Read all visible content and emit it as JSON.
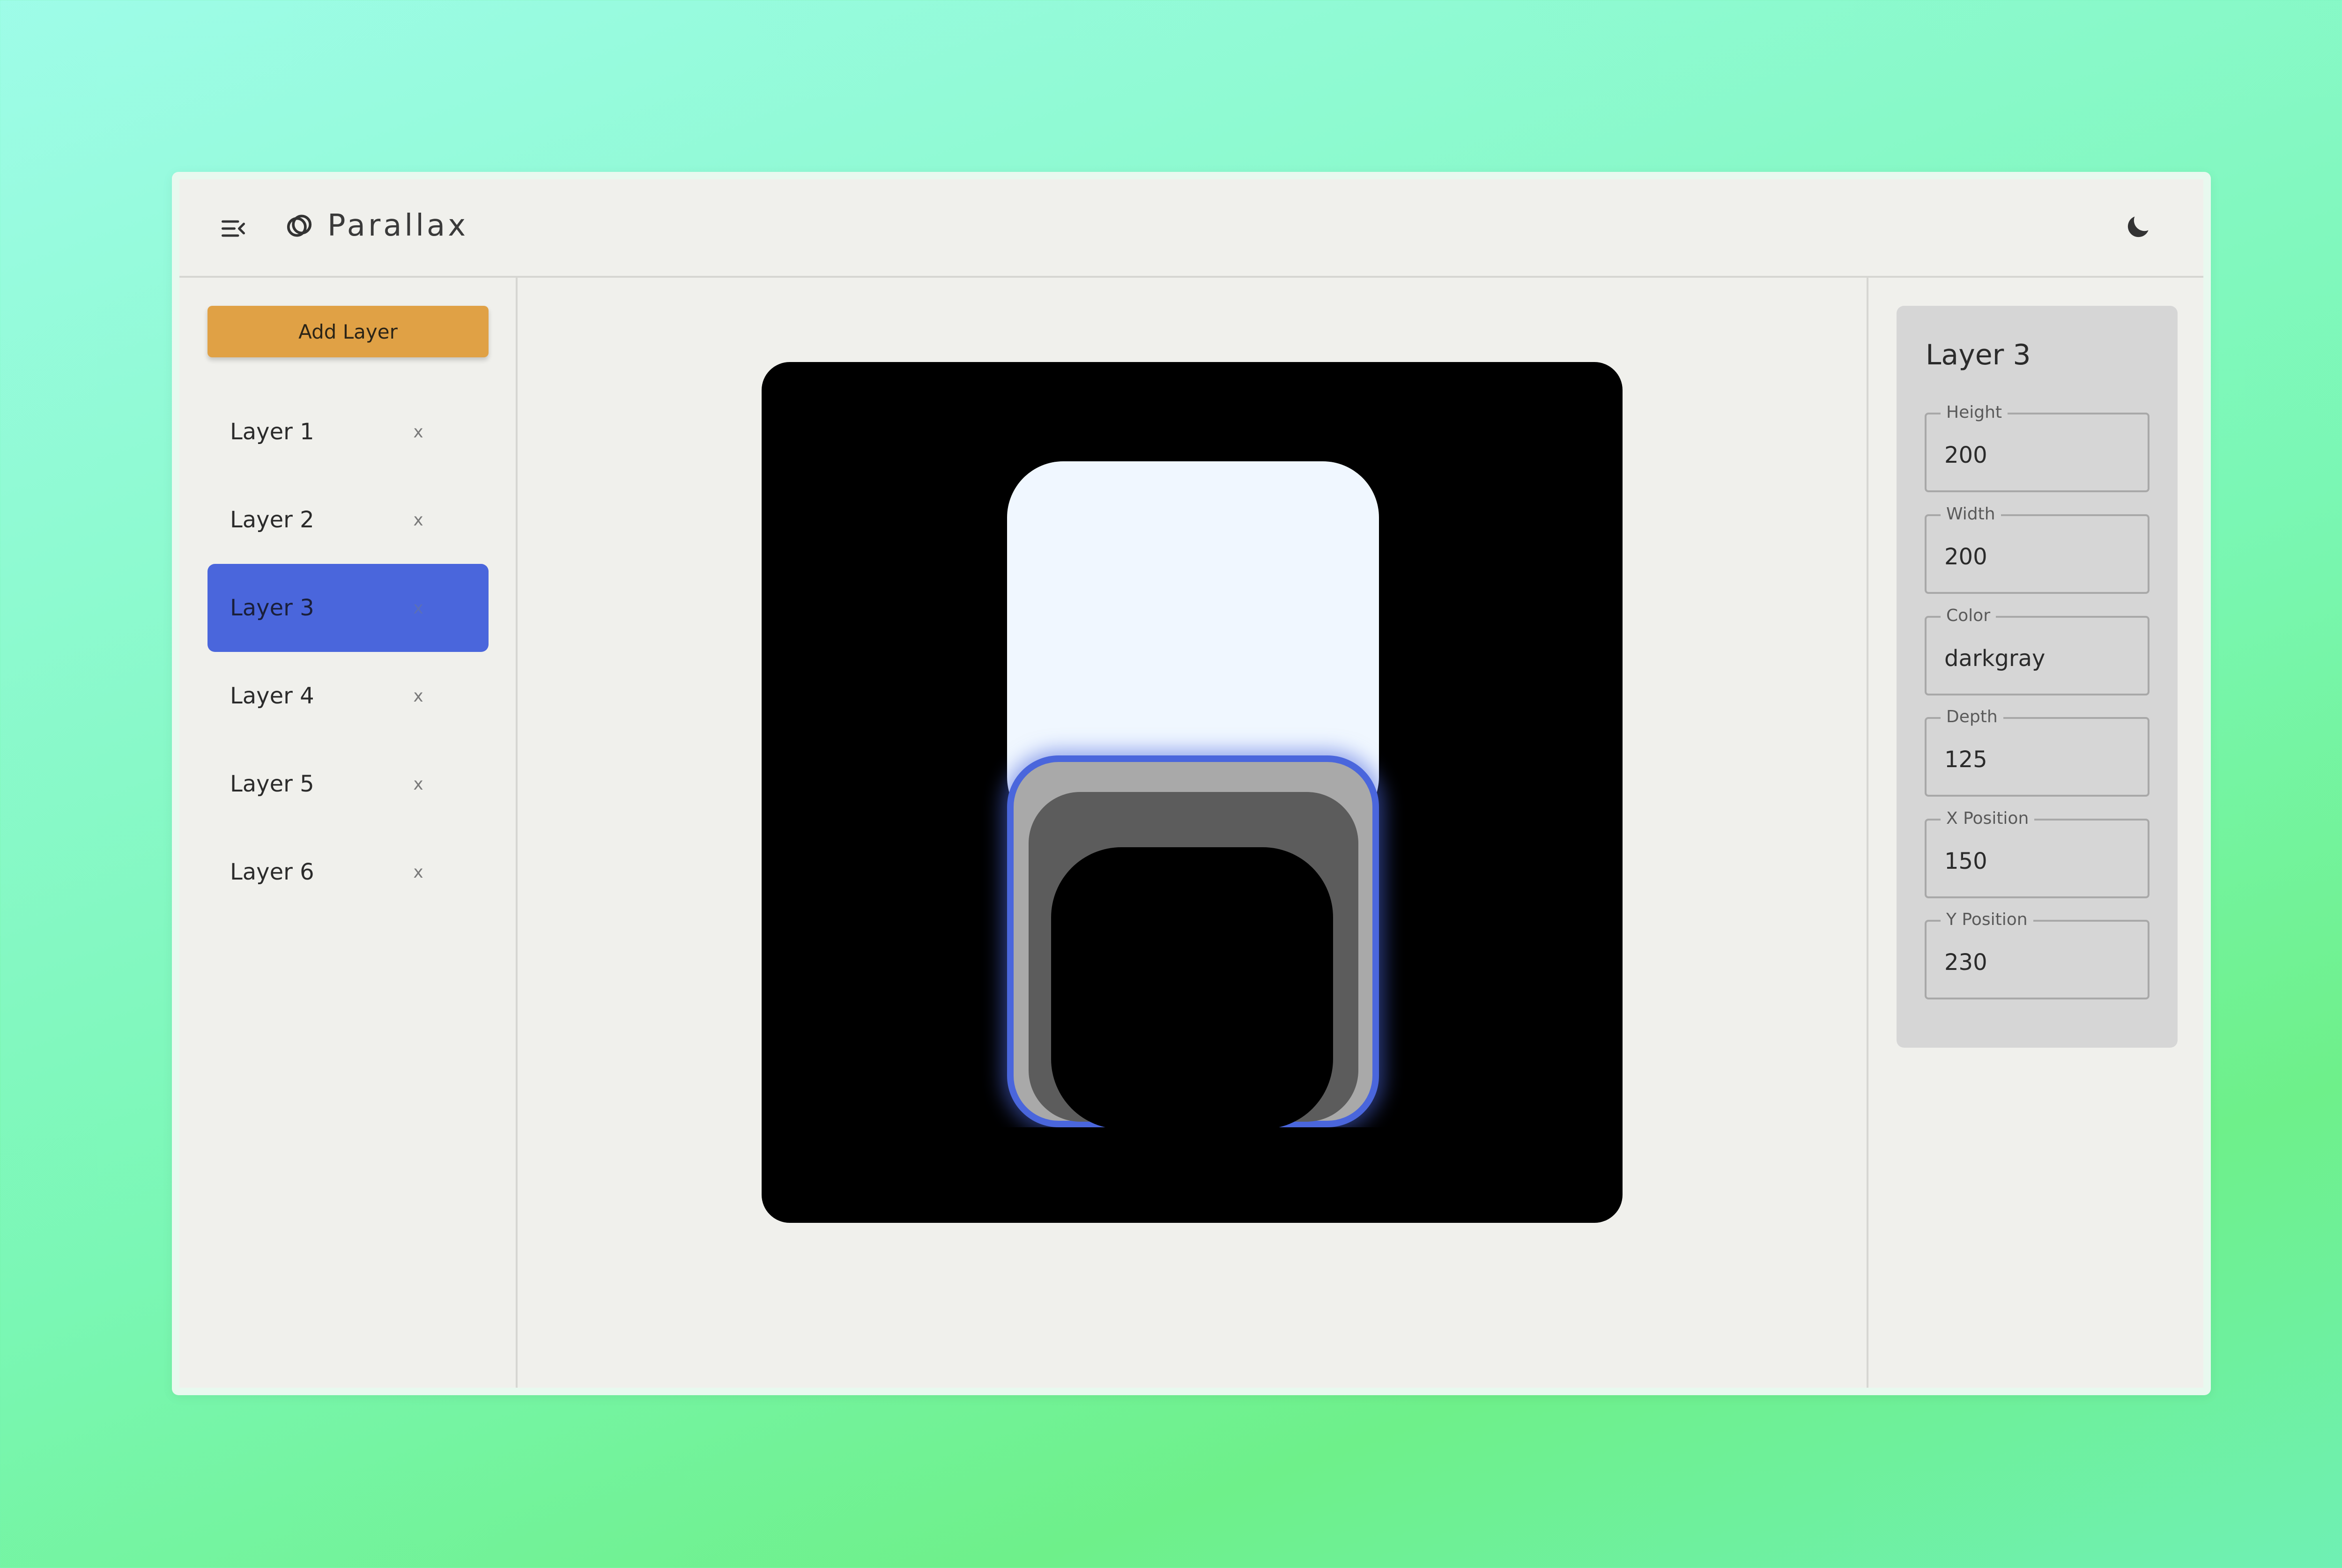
{
  "app": {
    "name": "Parallax",
    "menu_icon": "collapse-menu-icon",
    "logo_icon": "linked-rings-icon",
    "theme_icon": "moon-icon"
  },
  "sidebar": {
    "add_layer_label": "Add Layer",
    "remove_label": "x",
    "layers": [
      {
        "label": "Layer 1",
        "selected": false
      },
      {
        "label": "Layer 2",
        "selected": false
      },
      {
        "label": "Layer 3",
        "selected": true
      },
      {
        "label": "Layer 4",
        "selected": false
      },
      {
        "label": "Layer 5",
        "selected": false
      },
      {
        "label": "Layer 6",
        "selected": false
      }
    ]
  },
  "properties": {
    "title": "Layer 3",
    "fields": [
      {
        "label": "Height",
        "value": "200"
      },
      {
        "label": "Width",
        "value": "200"
      },
      {
        "label": "Color",
        "value": "darkgray"
      },
      {
        "label": "Depth",
        "value": "125"
      },
      {
        "label": "X Position",
        "value": "150"
      },
      {
        "label": "Y Position",
        "value": "230"
      }
    ]
  },
  "colors": {
    "accent": "#4a66dc",
    "add_button": "#e0a145",
    "stage_background": "#000000",
    "layer_1": "#f0f7ff",
    "layer_3": "#a9a9a9",
    "layer_4": "#5c5c5c",
    "layer_5": "#000000"
  }
}
